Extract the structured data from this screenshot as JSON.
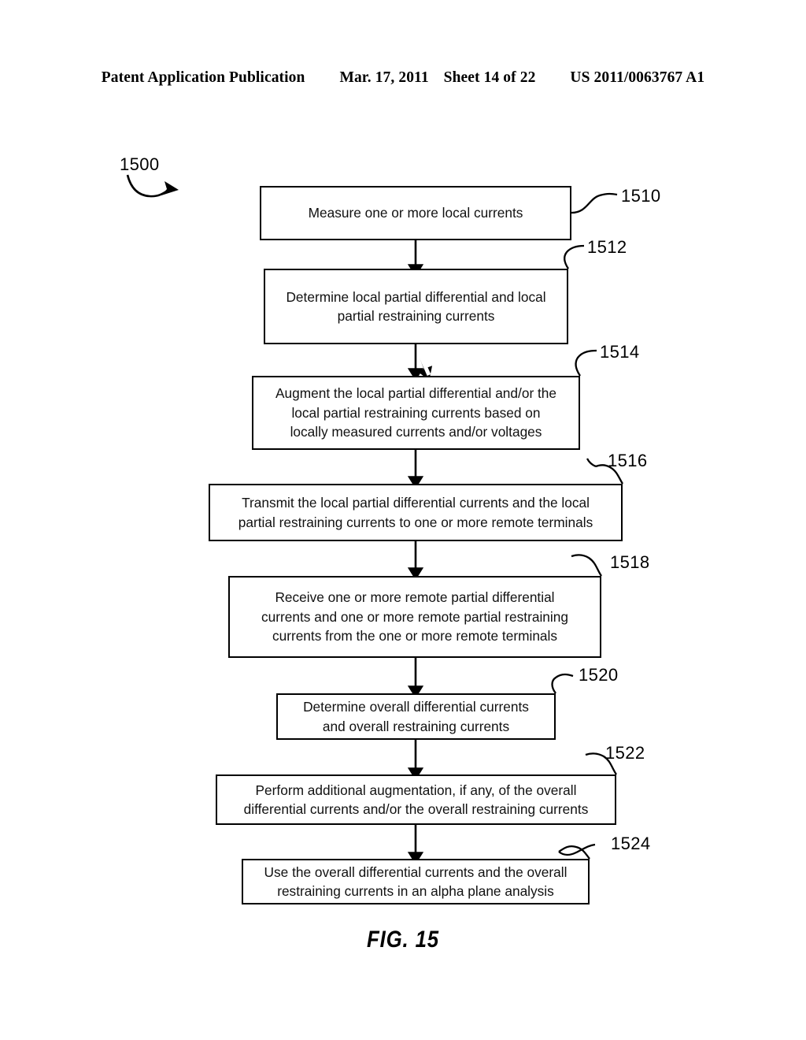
{
  "header": {
    "publication_label": "Patent Application Publication",
    "date": "Mar. 17, 2011",
    "sheet": "Sheet 14 of 22",
    "patent_number": "US 2011/0063767 A1"
  },
  "figure": {
    "caption": "FIG. 15",
    "diagram_label": "1500"
  },
  "flowchart": {
    "steps": [
      {
        "ref": "1510",
        "text": "Measure one or more local currents",
        "name": "step-measure-local-currents"
      },
      {
        "ref": "1512",
        "text": "Determine local partial differential and local\npartial restraining currents",
        "name": "step-determine-local-partials"
      },
      {
        "ref": "1514",
        "text": "Augment the local partial differential and/or the\nlocal partial restraining currents based on\nlocally measured currents and/or voltages",
        "name": "step-augment-local-partials"
      },
      {
        "ref": "1516",
        "text": "Transmit the local partial differential currents and the local\npartial restraining currents to one or more remote terminals",
        "name": "step-transmit-local-partials"
      },
      {
        "ref": "1518",
        "text": "Receive one or more remote partial differential\ncurrents and one or more remote partial restraining\ncurrents from the one or more remote terminals",
        "name": "step-receive-remote-partials"
      },
      {
        "ref": "1520",
        "text": "Determine overall differential currents\nand overall restraining currents",
        "name": "step-determine-overall-currents"
      },
      {
        "ref": "1522",
        "text": "Perform additional augmentation, if any, of the overall\ndifferential currents and/or the overall restraining currents",
        "name": "step-perform-additional-augmentation"
      },
      {
        "ref": "1524",
        "text": "Use the overall differential currents and the overall\nrestraining currents in an alpha plane analysis",
        "name": "step-use-in-alpha-plane-analysis"
      }
    ]
  },
  "colors": {
    "ink": "#000000",
    "paper": "#ffffff"
  }
}
